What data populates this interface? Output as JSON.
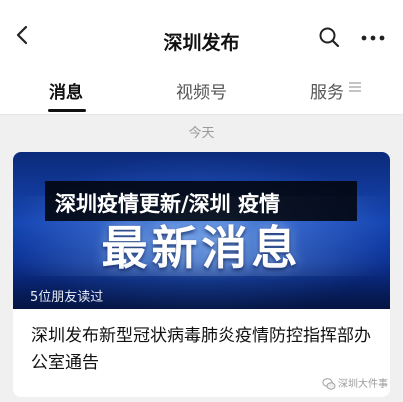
{
  "header": {
    "title": "深圳发布"
  },
  "tabs": [
    {
      "label": "消息",
      "active": true
    },
    {
      "label": "视频号",
      "active": false
    },
    {
      "label": "服务",
      "active": false
    }
  ],
  "feed": {
    "date_label": "今天",
    "article": {
      "cover_headline": "最新消息",
      "readers_label": "5位朋友读过",
      "title": "深圳发布新型冠状病毒肺炎疫情防控指挥部办公室通告"
    }
  },
  "overlay": {
    "caption": "深圳疫情更新/深圳 疫情"
  },
  "watermark": {
    "text": "深圳大件事"
  },
  "colors": {
    "cover_blue": "#1546b4",
    "tab_indicator": "#111111"
  }
}
